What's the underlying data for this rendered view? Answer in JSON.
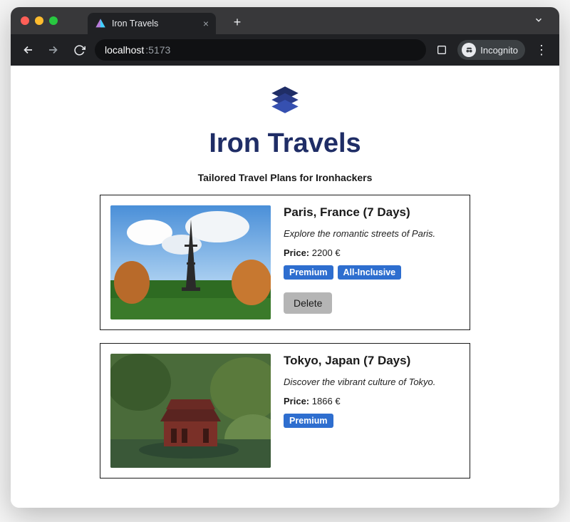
{
  "browser": {
    "tab_title": "Iron Travels",
    "url_host": "localhost",
    "url_path": ":5173",
    "incognito_label": "Incognito"
  },
  "app": {
    "title": "Iron Travels",
    "subtitle": "Tailored Travel Plans for Ironhackers",
    "price_label": "Price:",
    "currency": "€",
    "delete_label": "Delete"
  },
  "plans": [
    {
      "title": "Paris, France (7 Days)",
      "description": "Explore the romantic streets of Paris.",
      "price": "2200",
      "badges": [
        "Premium",
        "All-Inclusive"
      ]
    },
    {
      "title": "Tokyo, Japan (7 Days)",
      "description": "Discover the vibrant culture of Tokyo.",
      "price": "1866",
      "badges": [
        "Premium"
      ]
    }
  ],
  "colors": {
    "brand": "#1f2d66",
    "badge_bg": "#2e6ecf"
  }
}
